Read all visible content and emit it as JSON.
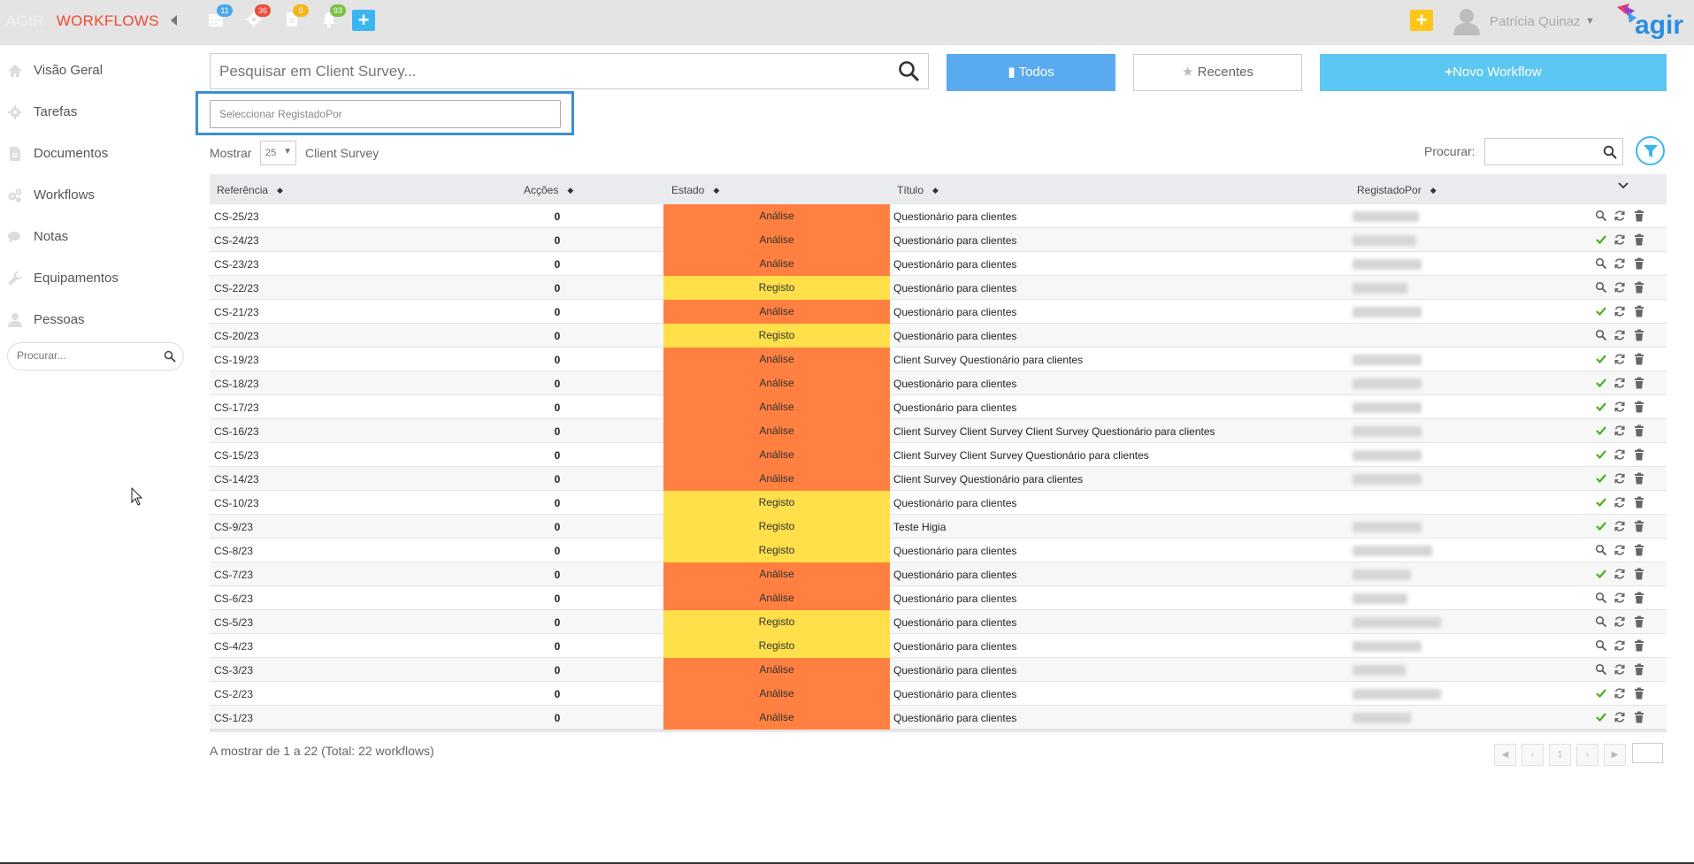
{
  "header": {
    "brand_left": "AGIR",
    "brand_right": "WORKFLOWS",
    "badges": {
      "calendar": "11",
      "settings": "36",
      "documents": "0",
      "notifications": "93"
    },
    "user_name": "Patrícia Quinaz",
    "logo_text": "agir"
  },
  "sidebar": {
    "items": [
      {
        "label": "Visão Geral",
        "icon": "home-icon"
      },
      {
        "label": "Tarefas",
        "icon": "gear-icon"
      },
      {
        "label": "Documentos",
        "icon": "file-icon"
      },
      {
        "label": "Workflows",
        "icon": "cogs-icon"
      },
      {
        "label": "Notas",
        "icon": "comments-icon"
      },
      {
        "label": "Equipamentos",
        "icon": "wrench-icon"
      },
      {
        "label": "Pessoas",
        "icon": "user-icon"
      }
    ],
    "search_placeholder": "Procurar..."
  },
  "toolbar": {
    "search_placeholder": "Pesquisar em Client Survey...",
    "todos_label": "Todos",
    "recentes_label": "Recentes",
    "novo_label": "Novo Workflow",
    "select_registado_placeholder": "Seleccionar RegistadoPor"
  },
  "list_controls": {
    "mostrar_label": "Mostrar",
    "page_size": "25",
    "module_name": "Client Survey",
    "procurar_label": "Procurar:"
  },
  "table": {
    "headers": [
      "Referência",
      "Acções",
      "Estado",
      "Título",
      "RegistadoPor"
    ],
    "rows": [
      {
        "ref": "CS-25/23",
        "acc": "0",
        "estado": "Análise",
        "titulo": "Questionário para clientes",
        "first": "view"
      },
      {
        "ref": "CS-24/23",
        "acc": "0",
        "estado": "Análise",
        "titulo": "Questionário para clientes",
        "first": "check"
      },
      {
        "ref": "CS-23/23",
        "acc": "0",
        "estado": "Análise",
        "titulo": "Questionário para clientes",
        "first": "view"
      },
      {
        "ref": "CS-22/23",
        "acc": "0",
        "estado": "Registo",
        "titulo": "Questionário para clientes",
        "first": "view"
      },
      {
        "ref": "CS-21/23",
        "acc": "0",
        "estado": "Análise",
        "titulo": "Questionário para clientes",
        "first": "check"
      },
      {
        "ref": "CS-20/23",
        "acc": "0",
        "estado": "Registo",
        "titulo": "Questionário para clientes",
        "first": "view"
      },
      {
        "ref": "CS-19/23",
        "acc": "0",
        "estado": "Análise",
        "titulo": "Client Survey Questionário para clientes",
        "first": "check"
      },
      {
        "ref": "CS-18/23",
        "acc": "0",
        "estado": "Análise",
        "titulo": "Questionário para clientes",
        "first": "check"
      },
      {
        "ref": "CS-17/23",
        "acc": "0",
        "estado": "Análise",
        "titulo": "Questionário para clientes",
        "first": "check"
      },
      {
        "ref": "CS-16/23",
        "acc": "0",
        "estado": "Análise",
        "titulo": "Client Survey Client Survey Client Survey Questionário para clientes",
        "first": "check"
      },
      {
        "ref": "CS-15/23",
        "acc": "0",
        "estado": "Análise",
        "titulo": "Client Survey Client Survey Questionário para clientes",
        "first": "check"
      },
      {
        "ref": "CS-14/23",
        "acc": "0",
        "estado": "Análise",
        "titulo": "Client Survey Questionário para clientes",
        "first": "check"
      },
      {
        "ref": "CS-10/23",
        "acc": "0",
        "estado": "Registo",
        "titulo": "Questionário para clientes",
        "first": "check"
      },
      {
        "ref": "CS-9/23",
        "acc": "0",
        "estado": "Registo",
        "titulo": "Teste Higia",
        "first": "check"
      },
      {
        "ref": "CS-8/23",
        "acc": "0",
        "estado": "Registo",
        "titulo": "Questionário para clientes",
        "first": "view"
      },
      {
        "ref": "CS-7/23",
        "acc": "0",
        "estado": "Análise",
        "titulo": "Questionário para clientes",
        "first": "check"
      },
      {
        "ref": "CS-6/23",
        "acc": "0",
        "estado": "Análise",
        "titulo": "Questionário para clientes",
        "first": "view"
      },
      {
        "ref": "CS-5/23",
        "acc": "0",
        "estado": "Registo",
        "titulo": "Questionário para clientes",
        "first": "view"
      },
      {
        "ref": "CS-4/23",
        "acc": "0",
        "estado": "Registo",
        "titulo": "Questionário para clientes",
        "first": "view"
      },
      {
        "ref": "CS-3/23",
        "acc": "0",
        "estado": "Análise",
        "titulo": "Questionário para clientes",
        "first": "view"
      },
      {
        "ref": "CS-2/23",
        "acc": "0",
        "estado": "Análise",
        "titulo": "Questionário para clientes",
        "first": "check"
      },
      {
        "ref": "CS-1/23",
        "acc": "0",
        "estado": "Análise",
        "titulo": "Questionário para clientes",
        "first": "check"
      }
    ]
  },
  "footer": {
    "info": "A mostrar de 1 a 22 (Total: 22 workflows)",
    "current_page": "1"
  },
  "colors": {
    "analise": "#ff8040",
    "registo": "#ffe04a",
    "todos_btn": "#5aaaf0",
    "novo_btn": "#5cc7f2",
    "brand_red": "#f04a32"
  }
}
